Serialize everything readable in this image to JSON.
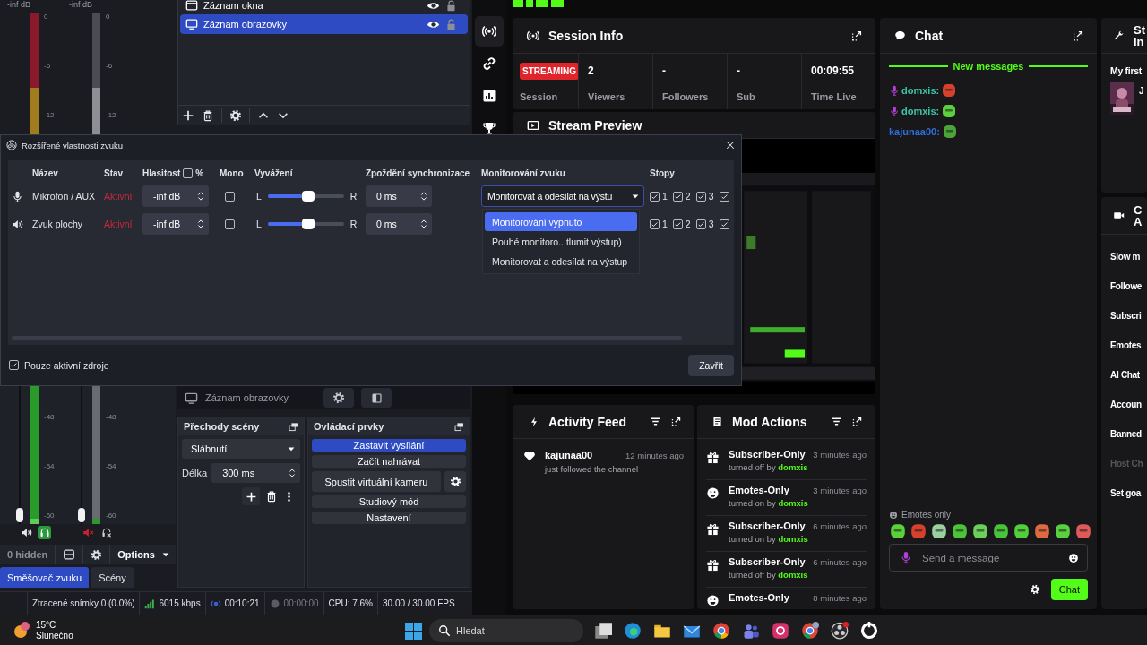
{
  "obs": {
    "top_meters": [
      {
        "reading": "-inf dB",
        "kind": "peak",
        "ticks": [
          "0",
          "-6",
          "-12"
        ]
      },
      {
        "reading": "-inf dB",
        "kind": "idle",
        "ticks": [
          "0",
          "-6",
          "-12"
        ]
      }
    ],
    "sources": [
      {
        "name": "Záznam okna",
        "kind": "window",
        "visible": true,
        "locked": false,
        "selected": false
      },
      {
        "name": "Záznam obrazovky",
        "kind": "display",
        "visible": true,
        "locked": false,
        "selected": true
      }
    ],
    "bottom_meters": [
      {
        "kind": "active",
        "ticks": [
          "-48",
          "-54",
          "-60"
        ],
        "muted": false,
        "monitoring": true
      },
      {
        "kind": "idle",
        "ticks": [
          "-48",
          "-54",
          "-60"
        ],
        "muted": true,
        "monitoring": false
      }
    ],
    "mixer_bar": {
      "hidden": "0 hidden",
      "options": "Options"
    },
    "dock_tabs": [
      {
        "label": "Směšovač zvuku",
        "selected": true
      },
      {
        "label": "Scény",
        "selected": false
      }
    ],
    "current_source": "Záznam obrazovky",
    "transitions": {
      "title": "Přechody scény",
      "transition": "Slábnutí",
      "duration_label": "Délka",
      "duration": "300 ms"
    },
    "controls": {
      "title": "Ovládací prvky",
      "buttons": [
        {
          "label": "Zastavit vysílání",
          "active": true,
          "kind": "plain"
        },
        {
          "label": "Začít nahrávat",
          "active": false,
          "kind": "plain"
        },
        {
          "label": "Spustit virtuální kameru",
          "active": false,
          "kind": "with-settings"
        },
        {
          "label": "Studiový mód",
          "active": false,
          "kind": "plain"
        },
        {
          "label": "Nastavení",
          "active": false,
          "kind": "plain"
        }
      ]
    },
    "status_bar": [
      {
        "kind": "dropped",
        "text": "Ztracené snímky 0 (0.0%)"
      },
      {
        "kind": "bitrate",
        "text": "6015 kbps"
      },
      {
        "kind": "stream",
        "text": "00:10:21"
      },
      {
        "kind": "record",
        "text": "00:00:00"
      },
      {
        "kind": "cpu",
        "text": "CPU: 7.6%"
      },
      {
        "kind": "fps",
        "text": "30.00 / 30.00 FPS"
      }
    ]
  },
  "dialog": {
    "title": "Rozšířené vlastnosti zvuku",
    "columns": [
      "Název",
      "Stav",
      "Hlasitost",
      "%",
      "Mono",
      "Vyvážení",
      "Zpoždění synchronizace",
      "Monitorování zvuku",
      "Stopy"
    ],
    "percent_checked": false,
    "rows": [
      {
        "kind": "mic",
        "name": "Mikrofon / AUX",
        "status": "Aktivní",
        "volume": "-inf dB",
        "mono": false,
        "level": 0.53,
        "left": "L",
        "right": "R",
        "sync": "0 ms",
        "monitoring": "Monitorovat a odesílat na výstu",
        "tracks": [
          {
            "label": "1",
            "checked": true
          },
          {
            "label": "2",
            "checked": true
          },
          {
            "label": "3",
            "checked": true
          },
          {
            "checked": true
          }
        ]
      },
      {
        "kind": "speaker",
        "name": "Zvuk plochy",
        "status": "Aktivní",
        "volume": "-inf dB",
        "mono": false,
        "level": 0.53,
        "left": "L",
        "right": "R",
        "sync": "0 ms",
        "tracks": [
          {
            "label": "1",
            "checked": true
          },
          {
            "label": "2",
            "checked": true
          },
          {
            "label": "3",
            "checked": true
          },
          {
            "checked": true
          }
        ]
      }
    ],
    "menu": [
      {
        "label": "Monitorování vypnuto",
        "highlighted": true
      },
      {
        "label": "Pouhé monitoro...tlumit výstup)",
        "highlighted": false
      },
      {
        "label": "Monitorovat a odesílat na výstup",
        "highlighted": false
      }
    ],
    "only_active": {
      "label": "Pouze aktivní zdroje",
      "checked": true
    },
    "close": "Zavřít"
  },
  "dashboard": {
    "rail": [
      {
        "kind": "broadcast",
        "selected": true
      },
      {
        "kind": "link",
        "selected": false
      },
      {
        "kind": "chart",
        "selected": false
      },
      {
        "kind": "trophy",
        "selected": false
      }
    ],
    "session": {
      "title": "Session Info",
      "badge": "STREAMING",
      "label": "Session",
      "stats": [
        {
          "value": "2",
          "label": "Viewers"
        },
        {
          "value": "-",
          "label": "Followers"
        },
        {
          "value": "-",
          "label": "Sub"
        },
        {
          "value": "00:09:55",
          "label": "Time Live"
        }
      ]
    },
    "preview": {
      "title": "Stream Preview"
    },
    "chat": {
      "title": "Chat",
      "divider": "New messages",
      "messages": [
        {
          "user": "domxis:",
          "color": "#3cc7a4",
          "badge": true
        },
        {
          "user": "domxis:",
          "color": "#3cc7a4",
          "badge": true
        },
        {
          "user": "kajunaa00:",
          "color": "#2f6fd8",
          "badge": false
        }
      ],
      "emotes_label": "Emotes only",
      "placeholder": "Send a message",
      "send": "Chat"
    },
    "stream_info": {
      "title_lines": [
        "St",
        "in"
      ],
      "item": "My first",
      "line": "J"
    },
    "chat_actions": {
      "title_lines": [
        "C",
        "A"
      ],
      "items": [
        {
          "label": "Slow m",
          "disabled": false
        },
        {
          "label": "Followe",
          "disabled": false
        },
        {
          "label": "Subscri",
          "disabled": false
        },
        {
          "label": "Emotes",
          "disabled": false
        },
        {
          "label": "AI Chat",
          "disabled": false
        },
        {
          "label": "Accoun",
          "disabled": false
        },
        {
          "label": "Banned",
          "disabled": false
        },
        {
          "label": "Host Ch",
          "disabled": true
        },
        {
          "label": "Set goa",
          "disabled": false
        }
      ]
    },
    "activity": {
      "title": "Activity Feed",
      "events": [
        {
          "user": "kajunaa00",
          "time": "12 minutes ago",
          "text": "just followed the channel"
        }
      ]
    },
    "mod_actions": {
      "title": "Mod Actions",
      "items": [
        {
          "kind": "gift",
          "title": "Subscriber-Only",
          "time": "3 minutes ago",
          "detail": "turned off by",
          "user": "domxis"
        },
        {
          "kind": "smile",
          "title": "Emotes-Only",
          "time": "3 minutes ago",
          "detail": "turned on by",
          "user": "domxis"
        },
        {
          "kind": "gift",
          "title": "Subscriber-Only",
          "time": "6 minutes ago",
          "detail": "turned on by",
          "user": "domxis"
        },
        {
          "kind": "gift",
          "title": "Subscriber-Only",
          "time": "6 minutes ago",
          "detail": "turned off by",
          "user": "domxis"
        },
        {
          "kind": "smile",
          "title": "Emotes-Only",
          "time": "8 minutes ago"
        }
      ]
    }
  },
  "taskbar": {
    "temperature": "15°C",
    "condition": "Slunečno",
    "search_placeholder": "Hledat"
  }
}
